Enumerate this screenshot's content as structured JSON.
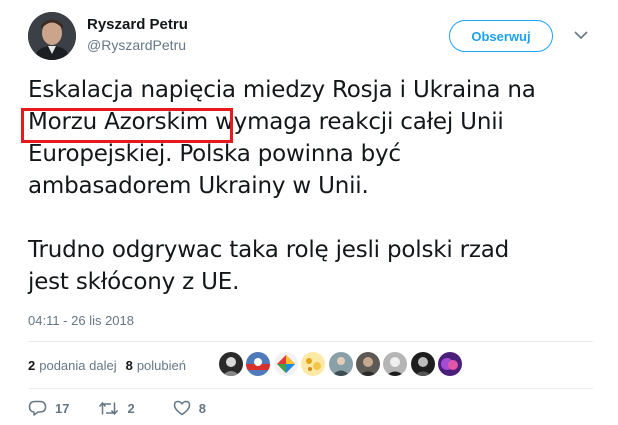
{
  "author": {
    "name": "Ryszard Petru",
    "handle": "@RyszardPetru"
  },
  "follow_button": {
    "label": "Obserwuj"
  },
  "menu": {
    "icon": "chevron-down-icon"
  },
  "tweet": {
    "lines": [
      "Eskalacja napięcia miedzy Rosja i Ukraina na",
      "Morzu Azorskim wymaga reakcji całej Unii",
      "Europejskiej. Polska powinna być",
      "ambasadorem Ukrainy w Unii.",
      "",
      "Trudno odgrywac taka rolę jesli polski rzad",
      "jest skłócony z UE."
    ],
    "highlighted_phrase": "Morzu Azorskim"
  },
  "timestamp": "04:11 - 26 lis 2018",
  "stats": {
    "retweets_count": "2",
    "retweets_label": "podania dalej",
    "likes_count": "8",
    "likes_label": "polubień"
  },
  "liker_avatars": [
    "avatar-1",
    "avatar-2",
    "avatar-3",
    "avatar-4",
    "avatar-5",
    "avatar-6",
    "avatar-7",
    "avatar-8",
    "avatar-9"
  ],
  "actions": {
    "reply_count": "17",
    "retweet_count": "2",
    "like_count": "8"
  },
  "colors": {
    "accent": "#1da1f2",
    "highlight_box": "#e8191c",
    "secondary_text": "#657786"
  }
}
